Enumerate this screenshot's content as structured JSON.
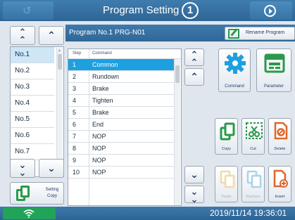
{
  "header": {
    "title": "Program Setting",
    "page_number": "1",
    "back_icon": "back-arrow-icon",
    "action_icon": "play-circle-icon"
  },
  "program_list": {
    "items": [
      {
        "label": "No.1",
        "selected": true
      },
      {
        "label": "No.2",
        "selected": false
      },
      {
        "label": "No.3",
        "selected": false
      },
      {
        "label": "No.4",
        "selected": false
      },
      {
        "label": "No.5",
        "selected": false
      },
      {
        "label": "No.6",
        "selected": false
      },
      {
        "label": "No.7",
        "selected": false
      }
    ],
    "copy_label_1": "Setting",
    "copy_label_2": "Copy"
  },
  "program_header": {
    "title": "Program No.1  PRG-N01",
    "rename_label": "Rename Program"
  },
  "steps": {
    "col_step": "Step",
    "col_command": "Command",
    "rows": [
      {
        "step": "1",
        "command": "Common",
        "selected": true
      },
      {
        "step": "2",
        "command": "Rundown",
        "selected": false
      },
      {
        "step": "3",
        "command": "Brake",
        "selected": false
      },
      {
        "step": "4",
        "command": "Tighten",
        "selected": false
      },
      {
        "step": "5",
        "command": "Brake",
        "selected": false
      },
      {
        "step": "6",
        "command": "End",
        "selected": false
      },
      {
        "step": "7",
        "command": "NOP",
        "selected": false
      },
      {
        "step": "8",
        "command": "NOP",
        "selected": false
      },
      {
        "step": "9",
        "command": "NOP",
        "selected": false
      },
      {
        "step": "10",
        "command": "NOP",
        "selected": false
      }
    ]
  },
  "actions": {
    "command": "Command",
    "parameter": "Parameter",
    "copy": "Copy",
    "cut": "Cut",
    "delete": "Delete",
    "paste": "Paste",
    "replace": "Replace",
    "insert": "Insert"
  },
  "status": {
    "datetime": "2019/11/14 19:36:01",
    "wifi_icon": "wifi-icon"
  },
  "colors": {
    "accent_blue": "#1ea0e0",
    "brand_green": "#2a9a4a",
    "delete_orange": "#e0662a",
    "header_blue": "#3f78aa"
  }
}
